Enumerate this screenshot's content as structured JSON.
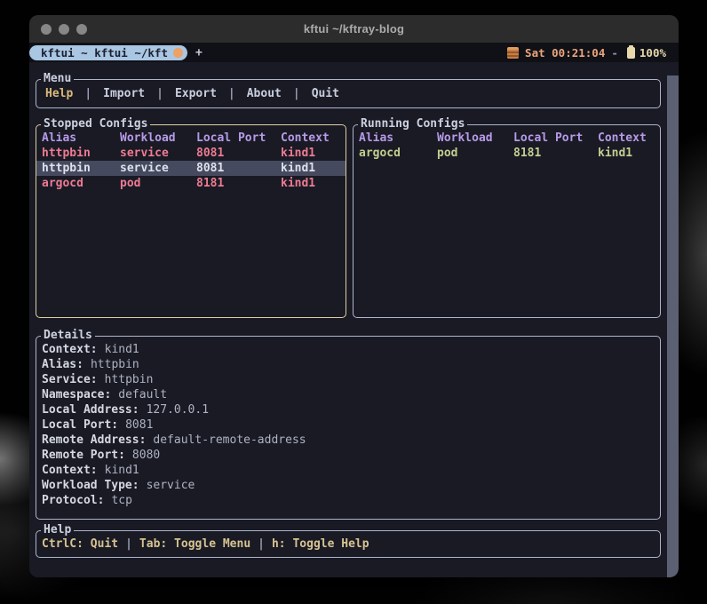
{
  "window": {
    "title": "kftui ~/kftray-blog"
  },
  "tabbar": {
    "tab_label": "kftui ~ kftui ~/kft",
    "new_tab": "+",
    "datetime": "Sat 00:21:04",
    "separator": "-",
    "battery": "100%"
  },
  "menu": {
    "title": "Menu",
    "separator": "|",
    "items": [
      {
        "label": "Help",
        "state": "active"
      },
      {
        "label": "Import",
        "state": "normal"
      },
      {
        "label": "Export",
        "state": "normal"
      },
      {
        "label": "About",
        "state": "normal"
      },
      {
        "label": "Quit",
        "state": "normal"
      }
    ]
  },
  "stopped": {
    "title": "Stopped Configs",
    "columns": [
      "Alias",
      "Workload",
      "Local Port",
      "Context"
    ],
    "rows": [
      {
        "alias": "httpbin",
        "workload": "service",
        "local_port": "8081",
        "context": "kind1",
        "state": "stopped"
      },
      {
        "alias": "httpbin",
        "workload": "service",
        "local_port": "8081",
        "context": "kind1",
        "state": "selected"
      },
      {
        "alias": "argocd",
        "workload": "pod",
        "local_port": "8181",
        "context": "kind1",
        "state": "stopped"
      }
    ]
  },
  "running": {
    "title": "Running Configs",
    "columns": [
      "Alias",
      "Workload",
      "Local Port",
      "Context"
    ],
    "rows": [
      {
        "alias": "argocd",
        "workload": "pod",
        "local_port": "8181",
        "context": "kind1",
        "state": "running"
      }
    ]
  },
  "details": {
    "title": "Details",
    "fields": [
      {
        "label": "Context:",
        "value": "kind1"
      },
      {
        "label": "Alias:",
        "value": "httpbin"
      },
      {
        "label": "Service:",
        "value": "httpbin"
      },
      {
        "label": "Namespace:",
        "value": "default"
      },
      {
        "label": "Local Address:",
        "value": "127.0.0.1"
      },
      {
        "label": "Local Port:",
        "value": "8081"
      },
      {
        "label": "Remote Address:",
        "value": "default-remote-address"
      },
      {
        "label": "Remote Port:",
        "value": "8080"
      },
      {
        "label": "Context:",
        "value": "kind1"
      },
      {
        "label": "Workload Type:",
        "value": "service"
      },
      {
        "label": "Protocol:",
        "value": "tcp"
      }
    ]
  },
  "help": {
    "title": "Help",
    "separator": "|",
    "shortcuts": [
      {
        "text": "CtrlC: Quit"
      },
      {
        "text": "Tab: Toggle Menu"
      },
      {
        "text": "h: Toggle Help"
      }
    ]
  },
  "colors": {
    "terminal_bg": "#191a24",
    "panel_border": "#aeb5cc",
    "focused_border": "#dfcf9f",
    "header_purple": "#b79ae8",
    "stopped_red": "#ee7b92",
    "running_green": "#c2ce8f",
    "selected_row_bg": "#454a5f",
    "menu_active_gold": "#d9b87c",
    "help_cream": "#d7c391",
    "tab_pill_blue": "#a9c6e2",
    "tab_dot_orange": "#eca266",
    "clock_peach": "#eba47c",
    "battery_cream": "#e8d8ac",
    "titlebar_gray": "#2c2c2d",
    "scrollbar_gray": "#5b6073"
  }
}
